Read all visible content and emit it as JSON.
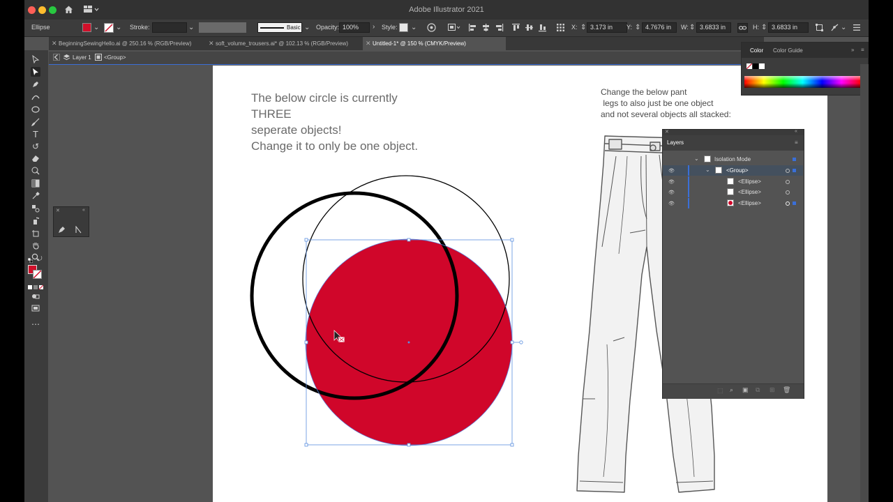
{
  "app": {
    "title": "Adobe Illustrator 2021"
  },
  "control_bar": {
    "selection_type": "Ellipse",
    "stroke_label": "Stroke:",
    "brush_label": "Basic",
    "opacity_label": "Opacity:",
    "opacity_value": "100%",
    "style_label": "Style:",
    "x_label": "X:",
    "x_value": "3.173 in",
    "y_label": "Y:",
    "y_value": "4.7676 in",
    "w_label": "W:",
    "w_value": "3.6833 in",
    "h_label": "H:",
    "h_value": "3.6833 in",
    "fill_color": "#d0102a"
  },
  "tabs": [
    {
      "label": "BeginningSewingHello.ai @ 250.16 % (RGB/Preview)",
      "active": false
    },
    {
      "label": "soft_volume_trousers.ai* @ 102.13 % (RGB/Preview)",
      "active": false
    },
    {
      "label": "Untitled-1* @ 150 % (CMYK/Preview)",
      "active": true
    }
  ],
  "breadcrumb": {
    "layer": "Layer 1",
    "group": "<Group>"
  },
  "artboard": {
    "left_instruction": [
      "The below circle is currently",
      "THREE",
      "seperate objects!",
      "Change it to only be one object."
    ],
    "right_instruction": [
      "Change the below pant",
      " legs to also just be one object",
      "and not several objects all stacked:"
    ],
    "circle_fill_color": "#d0062a"
  },
  "color_panel": {
    "tabs": [
      "Color",
      "Color Guide"
    ]
  },
  "layers_panel": {
    "title": "Layers",
    "rows": [
      {
        "label": "Isolation Mode",
        "indent": 0
      },
      {
        "label": "<Group>",
        "indent": 1,
        "selected": true
      },
      {
        "label": "<Ellipse>",
        "indent": 2,
        "swatch": "#ffffff"
      },
      {
        "label": "<Ellipse>",
        "indent": 2,
        "swatch": "#ffffff"
      },
      {
        "label": "<Ellipse>",
        "indent": 2,
        "swatch": "#d0062a"
      }
    ]
  }
}
